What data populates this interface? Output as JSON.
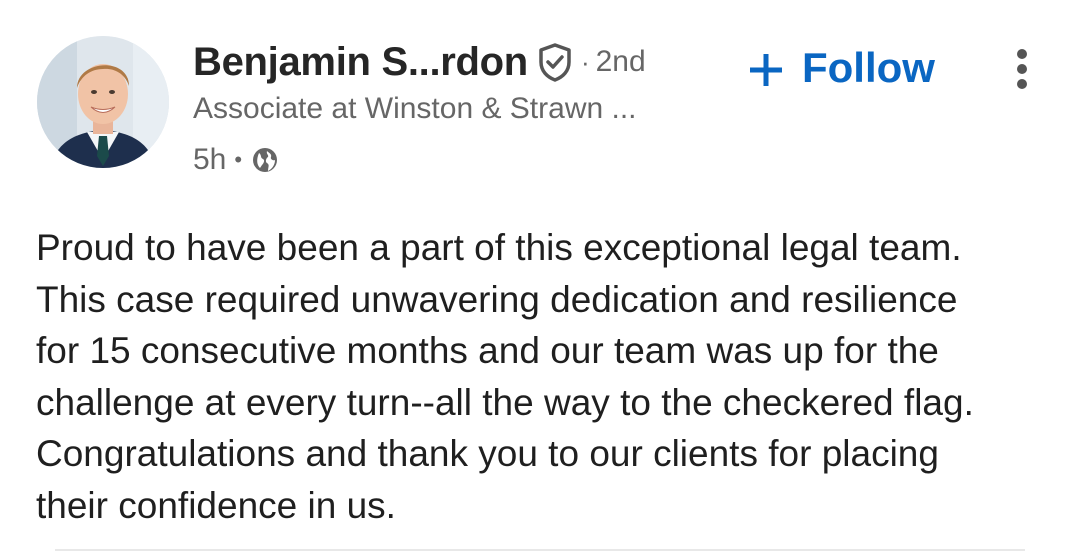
{
  "post": {
    "author": {
      "name": "Benjamin S...rdon",
      "degree": "2nd",
      "separator": "·",
      "headline": "Associate at Winston & Strawn ...",
      "timestamp": "5h",
      "meta_separator": "•",
      "avatar_icon": "profile-photo",
      "verified_icon": "shield-check-icon",
      "visibility_icon": "globe-icon"
    },
    "actions": {
      "follow_label": "Follow",
      "follow_icon": "plus-icon",
      "more_icon": "vertical-ellipsis-icon"
    },
    "body": {
      "lines": [
        "Proud to have been a part of this exceptional legal team.",
        "This case required unwavering dedication and resilience",
        "for 15 consecutive months and our team was up for the",
        "challenge at every turn--all the way to the checkered flag.",
        "Congratulations and thank you to our clients for placing",
        "their confidence in us."
      ]
    },
    "colors": {
      "accent": "#0a66c2",
      "text_primary": "#1f1f1f",
      "text_secondary": "#666666"
    }
  }
}
